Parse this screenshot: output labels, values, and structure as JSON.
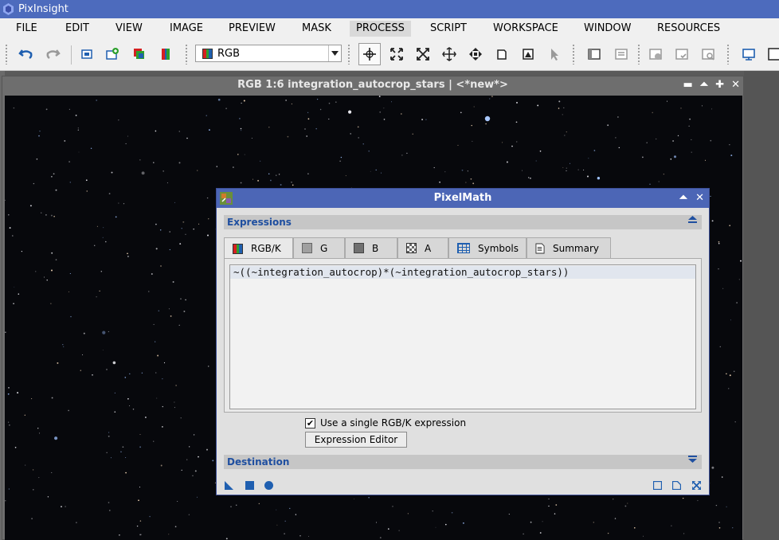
{
  "app": {
    "title": "PixInsight"
  },
  "menu": [
    "FILE",
    "EDIT",
    "VIEW",
    "IMAGE",
    "PREVIEW",
    "MASK",
    "PROCESS",
    "SCRIPT",
    "WORKSPACE",
    "WINDOW",
    "RESOURCES"
  ],
  "menu_active": "PROCESS",
  "toolbar": {
    "channel_select": "RGB"
  },
  "image_window": {
    "title": "RGB 1:6 integration_autocrop_stars | <*new*>"
  },
  "pixelmath": {
    "title": "PixelMath",
    "expressions_label": "Expressions",
    "tabs": [
      "RGB/K",
      "G",
      "B",
      "A",
      "Symbols",
      "Summary"
    ],
    "active_tab": "RGB/K",
    "expression": "~((~integration_autocrop)*(~integration_autocrop_stars))",
    "single_expr_label": "Use a single RGB/K expression",
    "single_expr_checked": true,
    "expression_editor_label": "Expression Editor",
    "destination_label": "Destination"
  },
  "colors": {
    "title_blue": "#4c66b6",
    "section_text": "#1f4fa0",
    "icon_blue": "#1f5fb0"
  }
}
